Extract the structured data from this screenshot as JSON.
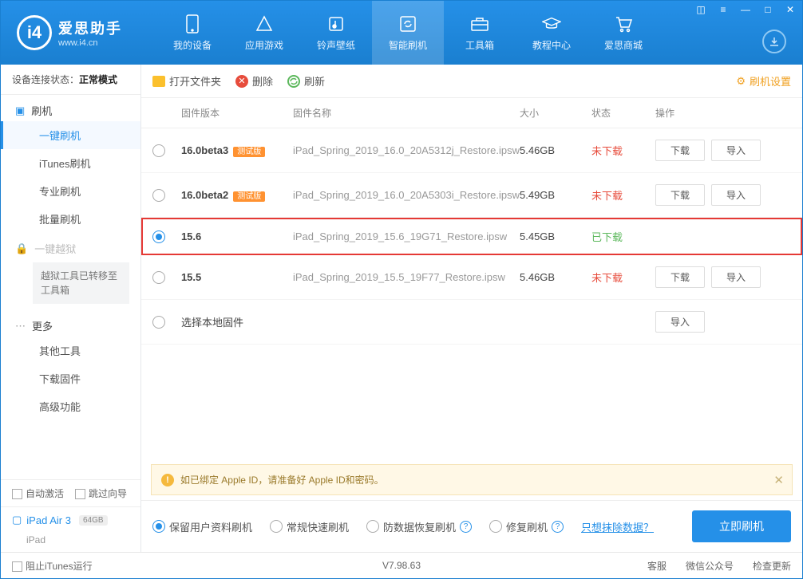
{
  "logo": {
    "title": "爱思助手",
    "sub": "www.i4.cn",
    "glyph": "i4"
  },
  "nav": [
    {
      "label": "我的设备"
    },
    {
      "label": "应用游戏"
    },
    {
      "label": "铃声壁纸"
    },
    {
      "label": "智能刷机"
    },
    {
      "label": "工具箱"
    },
    {
      "label": "教程中心"
    },
    {
      "label": "爱思商城"
    }
  ],
  "connection": {
    "prefix": "设备连接状态：",
    "mode": "正常模式"
  },
  "sidebar": {
    "group_flash": "刷机",
    "items_flash": [
      "一键刷机",
      "iTunes刷机",
      "专业刷机",
      "批量刷机"
    ],
    "group_jailbreak": "一键越狱",
    "jailbreak_notice": "越狱工具已转移至工具箱",
    "group_more": "更多",
    "items_more": [
      "其他工具",
      "下载固件",
      "高级功能"
    ],
    "auto_activate": "自动激活",
    "skip_wizard": "跳过向导",
    "device_name": "iPad Air 3",
    "device_storage": "64GB",
    "device_type": "iPad"
  },
  "toolbar": {
    "open": "打开文件夹",
    "delete": "删除",
    "refresh": "刷新",
    "settings": "刷机设置"
  },
  "columns": {
    "version": "固件版本",
    "name": "固件名称",
    "size": "大小",
    "status": "状态",
    "ops": "操作"
  },
  "rows": [
    {
      "selected": false,
      "version": "16.0beta3",
      "tag": "测试版",
      "name": "iPad_Spring_2019_16.0_20A5312j_Restore.ipsw",
      "size": "5.46GB",
      "status": "未下载",
      "status_class": "st-not",
      "show_dl": true
    },
    {
      "selected": false,
      "version": "16.0beta2",
      "tag": "测试版",
      "name": "iPad_Spring_2019_16.0_20A5303i_Restore.ipsw",
      "size": "5.49GB",
      "status": "未下载",
      "status_class": "st-not",
      "show_dl": true
    },
    {
      "selected": true,
      "version": "15.6",
      "tag": "",
      "name": "iPad_Spring_2019_15.6_19G71_Restore.ipsw",
      "size": "5.45GB",
      "status": "已下载",
      "status_class": "st-done",
      "show_dl": false
    },
    {
      "selected": false,
      "version": "15.5",
      "tag": "",
      "name": "iPad_Spring_2019_15.5_19F77_Restore.ipsw",
      "size": "5.46GB",
      "status": "未下载",
      "status_class": "st-not",
      "show_dl": true
    }
  ],
  "local_row": {
    "label": "选择本地固件"
  },
  "buttons": {
    "download": "下载",
    "import": "导入"
  },
  "info": "如已绑定 Apple ID，请准备好 Apple ID和密码。",
  "options": {
    "keep_data": "保留用户资料刷机",
    "normal": "常规快速刷机",
    "anti_recovery": "防数据恢复刷机",
    "repair": "修复刷机",
    "erase_link": "只想抹除数据？",
    "go": "立即刷机"
  },
  "footer": {
    "block_itunes": "阻止iTunes运行",
    "version": "V7.98.63",
    "support": "客服",
    "wechat": "微信公众号",
    "update": "检查更新"
  }
}
